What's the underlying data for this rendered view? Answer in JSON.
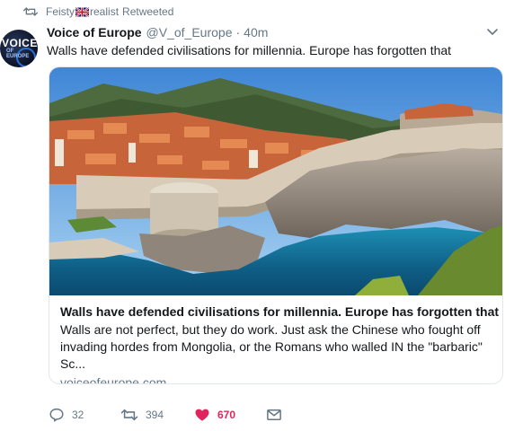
{
  "retweet": {
    "name_prefix": "Feisty",
    "name_suffix": "realist",
    "action": "Retweeted"
  },
  "tweet": {
    "author_name": "Voice of Europe",
    "handle": "@V_of_Europe",
    "separator": "·",
    "time": "40m",
    "text": "Walls have defended civilisations for millennia. Europe has forgotten that",
    "avatar_text": "VOICE",
    "avatar_subtext": "OF EUROPE"
  },
  "card": {
    "title": "Walls have defended civilisations for millennia. Europe has forgotten that",
    "description": "Walls are not perfect, but they do work. Just ask the Chinese who fought off invading hordes from Mongolia, or the Romans who walled IN the \"barbaric\" Sc...",
    "domain": "voiceofeurope.com"
  },
  "actions": {
    "reply_count": "32",
    "retweet_count": "394",
    "like_count": "670"
  },
  "colors": {
    "text_primary": "#14171a",
    "text_secondary": "#657786",
    "like_active": "#e0245e",
    "border": "#e1e8ed"
  }
}
